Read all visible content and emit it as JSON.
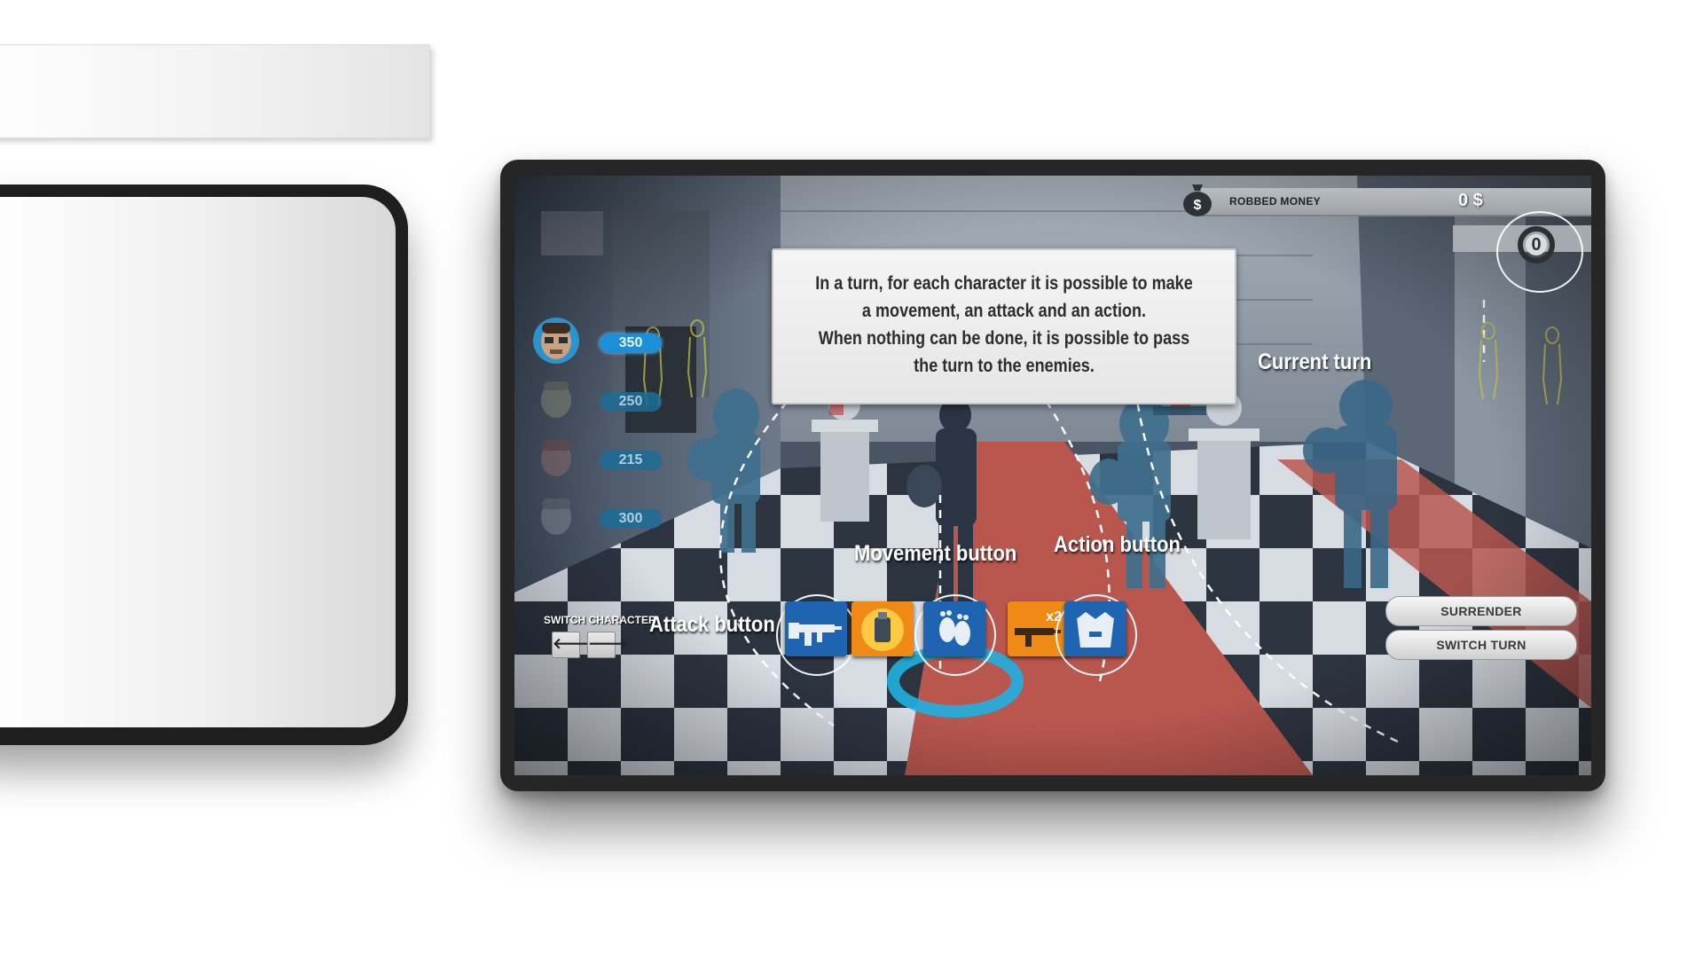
{
  "hud": {
    "robbed_money_label": "ROBBED MONEY",
    "robbed_money_value": "0 $",
    "turn_counter": "0"
  },
  "info_box": {
    "lines": [
      "In a turn, for each character it is possible to make",
      "a movement, an attack and an action.",
      "When nothing can be done, it is possible to pass",
      "the turn to the enemies."
    ]
  },
  "characters": [
    {
      "hp": "350",
      "active": true
    },
    {
      "hp": "250",
      "active": false
    },
    {
      "hp": "215",
      "active": false
    },
    {
      "hp": "300",
      "active": false
    }
  ],
  "switch_character": {
    "label": "SWITCH CHARACTER",
    "prev": "🡐",
    "next": "🡒"
  },
  "callouts": {
    "current_turn": "Current turn",
    "movement": "Movement button",
    "action": "Action button",
    "attack": "Attack button"
  },
  "buttons": {
    "surrender": "SURRENDER",
    "switch_turn": "SWITCH TURN"
  },
  "badges": {
    "double": "x2"
  },
  "colors": {
    "hp_pill": "#1c8fd6",
    "highlight_ring": "#1fb0e0",
    "enemy_red": "#c0332f",
    "carpet": "#b9574f",
    "weapon_icon_bg": "#1e64b0",
    "bonus_icon_bg": "#f08a16"
  }
}
